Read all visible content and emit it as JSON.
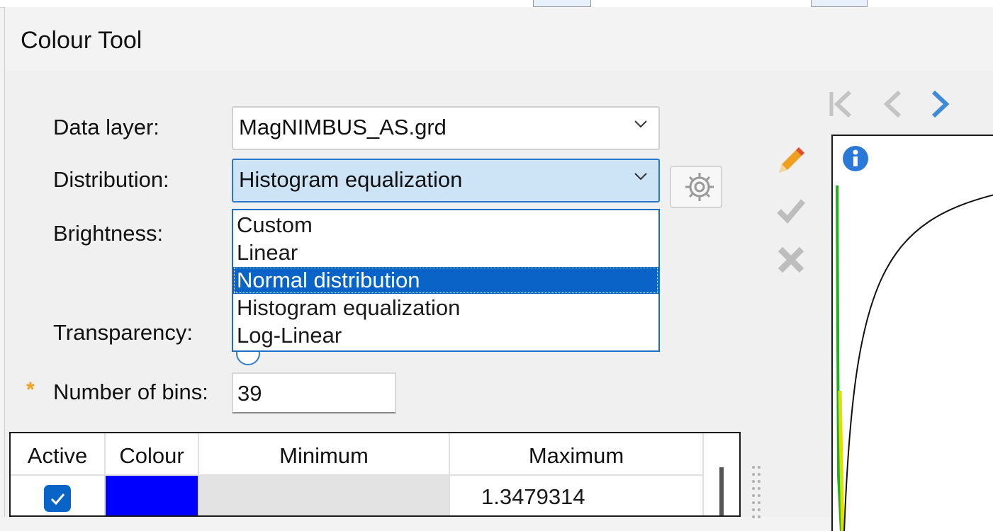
{
  "window": {
    "title": "Colour Tool"
  },
  "form": {
    "data_layer_label": "Data layer:",
    "data_layer_value": "MagNIMBUS_AS.grd",
    "distribution_label": "Distribution:",
    "distribution_value": "Histogram equalization",
    "brightness_label": "Brightness:",
    "transparency_label": "Transparency:",
    "bins_label": "Number of bins:",
    "bins_value": "39",
    "required_marker": "*"
  },
  "distribution_options": [
    "Custom",
    "Linear",
    "Normal distribution",
    "Histogram equalization",
    "Log-Linear"
  ],
  "distribution_highlighted": "Normal distribution",
  "table": {
    "headers": [
      "Active",
      "Colour",
      "Minimum",
      "Maximum"
    ],
    "rows": [
      {
        "active": true,
        "colour": "#0000ff",
        "minimum": "",
        "maximum": "1.3479314"
      }
    ]
  },
  "icons": [
    "chevron-down-icon",
    "gear-icon",
    "pencil-icon",
    "checkmark-icon",
    "close-icon",
    "info-icon",
    "first-page-icon",
    "previous-icon",
    "next-icon"
  ],
  "colors": {
    "accent": "#0a64c8",
    "highlight": "#cde4f7",
    "swatch": "#0000ff",
    "required": "#f0a21c"
  }
}
